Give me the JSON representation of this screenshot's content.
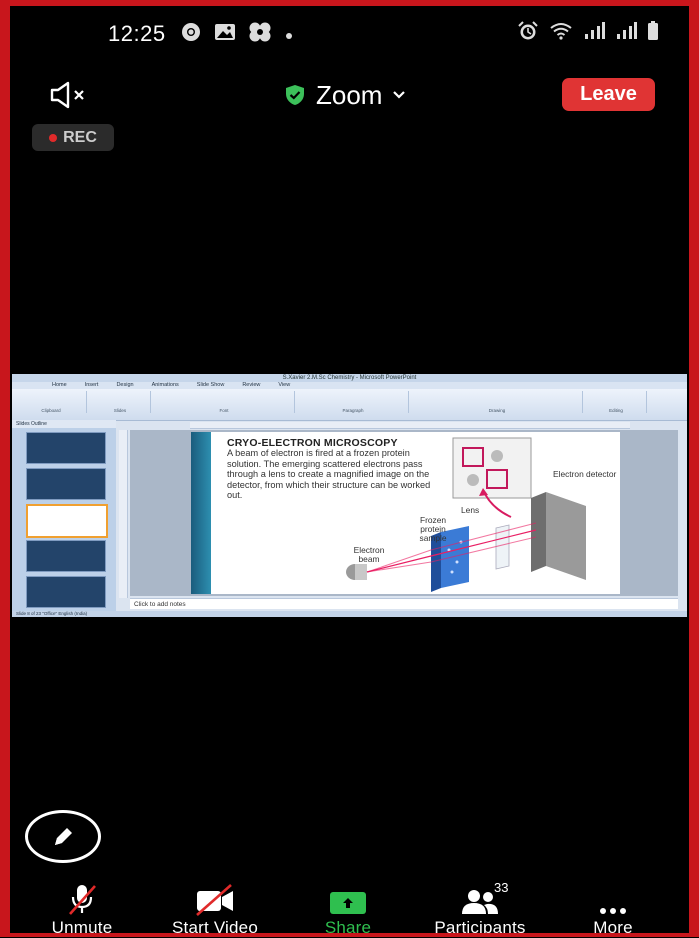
{
  "status_bar": {
    "time": "12:25",
    "left_icons": [
      "chrome-icon",
      "gallery-icon",
      "game-icon",
      "dot-icon"
    ],
    "right_icons": [
      "alarm-icon",
      "wifi-icon",
      "signal-icon",
      "signal-icon",
      "battery-icon"
    ]
  },
  "header": {
    "meeting_title": "Zoom",
    "leave_label": "Leave",
    "rec_label": "REC"
  },
  "shared_screen": {
    "window_title": "S.Xavier 2.M.Sc Chemistry - Microsoft PowerPoint",
    "ribbon_tabs": [
      "Home",
      "Insert",
      "Design",
      "Animations",
      "Slide Show",
      "Review",
      "View"
    ],
    "ribbon_groups": [
      "Clipboard",
      "Slides",
      "Font",
      "Paragraph",
      "Drawing",
      "Editing"
    ],
    "pane_tabs": "Slides   Outline",
    "slide": {
      "heading": "CRYO-ELECTRON MICROSCOPY",
      "body": "A beam of electron is fired at a frozen protein solution. The emerging scattered electrons pass through a lens to create a magnified image on the detector, from which their structure can be worked out.",
      "label_electron_detector": "Electron detector",
      "label_lens": "Lens",
      "label_frozen_protein": "Frozen protein sample",
      "label_electron_beam": "Electron beam"
    },
    "notes_placeholder": "Click to add notes",
    "status_text": "Slide 8 of 23    \"Office\"    English (India)"
  },
  "toolbar": {
    "unmute": "Unmute",
    "start_video": "Start Video",
    "share": "Share",
    "participants": "Participants",
    "participants_count": "33",
    "more": "More"
  },
  "colors": {
    "leave": "#e03434",
    "share_green": "#2fbf4f",
    "shield_green": "#3cc05a",
    "frame_red": "#c8161c"
  }
}
